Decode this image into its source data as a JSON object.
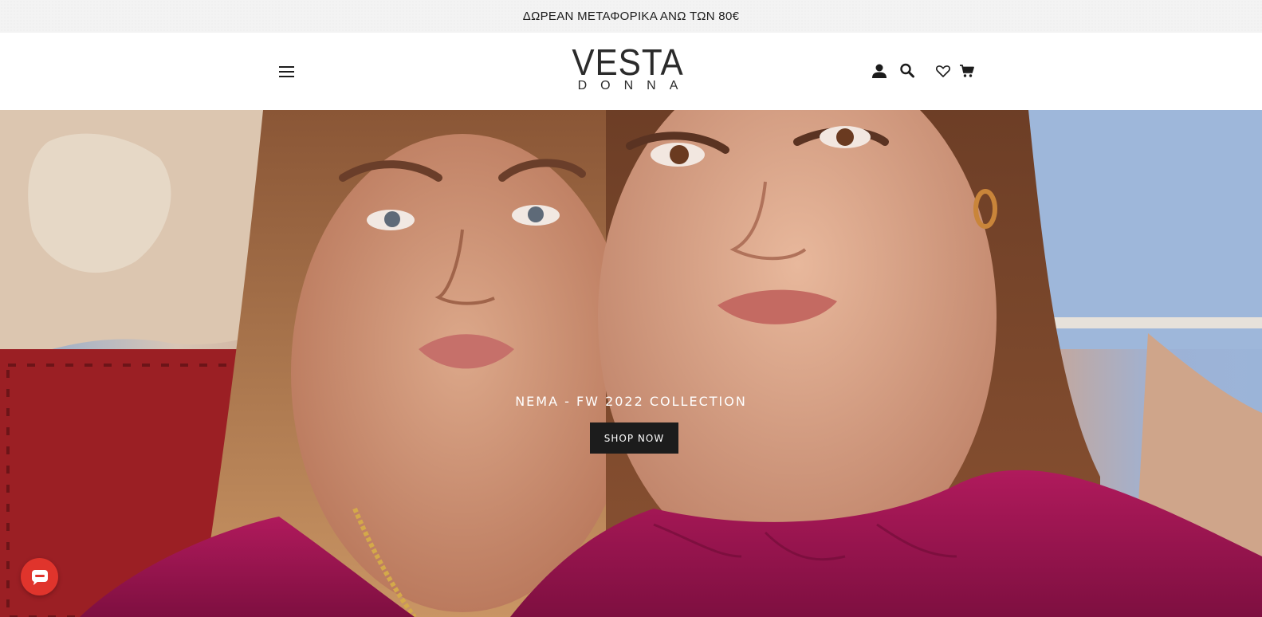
{
  "announcement": {
    "text": "ΔΩΡΕΑΝ ΜΕΤΑΦΟΡΙΚΑ ΑΝΩ ΤΩΝ 80€"
  },
  "header": {
    "logo_main": "VESTA",
    "logo_sub": "DONNA",
    "icons": [
      "menu-icon",
      "account-icon",
      "search-icon",
      "wishlist-heart-icon",
      "cart-icon"
    ]
  },
  "hero": {
    "caption": "NEMA - FW 2022 COLLECTION",
    "cta_label": "SHOP NOW",
    "image": "two-models-portrait"
  },
  "chat": {
    "icon": "chat-bubble-icon",
    "color": "#e0342c"
  },
  "colors": {
    "text": "#1c1c1c",
    "button_bg": "#1c1c1c",
    "button_text": "#ffffff",
    "blouse": "#9b1450"
  }
}
